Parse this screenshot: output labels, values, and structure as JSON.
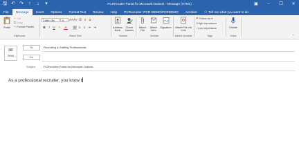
{
  "window": {
    "title": "PCRecruiter Portal for Microsoft Outlook  -  Message (HTML)",
    "qat_icons": [
      "save-icon",
      "undo-icon",
      "redo-icon",
      "up-icon",
      "down-icon",
      "customize-icon"
    ],
    "controls": [
      "ribbon-display-icon",
      "minimize-icon",
      "restore-icon",
      "close-icon"
    ]
  },
  "tabs": [
    "File",
    "Message",
    "Insert",
    "Options",
    "Format Text",
    "Review",
    "Help",
    "PCRecruiter: PCR DEMO\\PCRDEMO",
    "Acrobat"
  ],
  "active_tab": "Message",
  "tell_me": "Tell me what you want to do",
  "ribbon": {
    "clipboard": {
      "label": "Clipboard",
      "paste": "Paste",
      "cut": "Cut",
      "copy": "Copy",
      "format_painter": "Format Painter"
    },
    "basic_text": {
      "label": "Basic Text",
      "font_name": "Calibri (Bo",
      "font_size": "11",
      "bold": "B",
      "italic": "I",
      "underline": "U",
      "font_color": "A"
    },
    "names": {
      "label": "Names",
      "address_book": "Address Book",
      "check_names": "Check Names"
    },
    "include": {
      "label": "Include",
      "attach_file": "Attach File",
      "attach_item": "Attach Item",
      "signature": "Signature"
    },
    "adobe": {
      "label": "Adobe Acrobat",
      "attach_via_link": "Attach File via Link"
    },
    "tags": {
      "label": "Tags",
      "follow_up": "Follow Up",
      "high_importance": "High Importance",
      "low_importance": "Low Importance"
    },
    "voice": {
      "label": "Voice",
      "dictate": "Dictate"
    }
  },
  "compose": {
    "send": "Send",
    "to_label": "To",
    "to_value": "Recruiting & Staffing Professionals",
    "cc_label": "Cc",
    "cc_value": "",
    "subject_label": "Subject",
    "subject_value": "PCRecruiter Portal for Microsoft Outlook",
    "body": "As a professional recruiter, you know t"
  },
  "colors": {
    "accent": "#2b63ad",
    "ribbon_bg": "#f3f3f3",
    "follow_up_flag": "#d13438",
    "font_color_bar": "#e81123"
  }
}
